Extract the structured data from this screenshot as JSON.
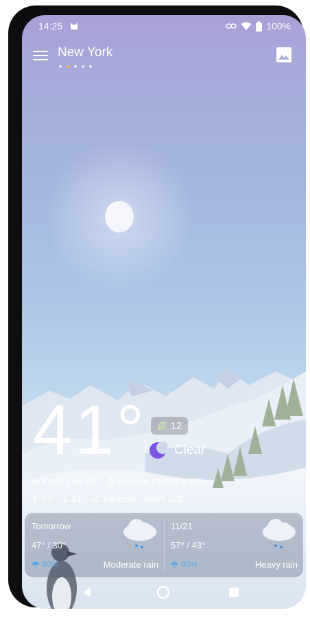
{
  "status_bar": {
    "time": "14:25",
    "battery": "100%",
    "icons": [
      "cat-notification-icon",
      "link-icon",
      "wifi-icon",
      "battery-icon"
    ]
  },
  "app_bar": {
    "city": "New York",
    "page_count": 5,
    "active_page": 2,
    "menu_icon": "hamburger-menu-icon",
    "background_icon": "image-icon"
  },
  "current": {
    "temperature": "41°",
    "aqi": "12",
    "condition": "Clear",
    "feels_like": "Feels Like 35°",
    "humidity": "Relative Humidity 46%",
    "high": "43°",
    "low": "34°",
    "wind": "3.6 km/h , NNW 328°"
  },
  "forecast": [
    {
      "label": "Tomorrow",
      "temps": "47° / 30°",
      "precip": "80%",
      "condition": "Moderate rain",
      "icon": "rain-cloud-icon"
    },
    {
      "label": "11/21",
      "temps": "57° / 43°",
      "precip": "80%",
      "condition": "Heavy rain",
      "icon": "rain-cloud-icon"
    }
  ],
  "colors": {
    "sky_top": "#a9a0d8",
    "sky_bottom": "#e4ecf6",
    "accent_dot": "#f2b63d",
    "moon_icon": "#7e55e0",
    "precip_text": "#5aa6e8"
  }
}
